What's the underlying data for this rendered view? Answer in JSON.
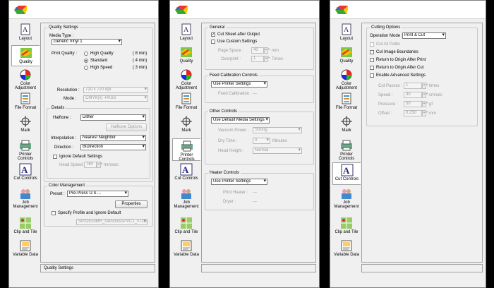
{
  "sidebar_labels": {
    "layout": "Layout",
    "quality": "Quality",
    "color_adjustment": "Color Adjustment",
    "file_format": "File Format",
    "mark": "Mark",
    "printer_controls": "Printer Controls",
    "cut_controls": "Cut Controls",
    "job_management": "Job Management",
    "clip_and_tile": "Clip and Tile",
    "variable_data": "Variable Data"
  },
  "panel1": {
    "quality_settings": {
      "title": "Quality Settings",
      "media_type_label": "Media Type :",
      "media_type_value": "Generic Vinyl 1",
      "print_quality_label": "Print Quality :",
      "options": [
        {
          "label": "High Quality",
          "time": "( 8 min)"
        },
        {
          "label": "Standard",
          "time": "( 4 min)"
        },
        {
          "label": "High Speed",
          "time": "( 3 min)"
        }
      ],
      "resolution_label": "Resolution :",
      "resolution_value": "720 x 720 dpi",
      "mode_label": "Mode :",
      "mode_value": "CMYK(v) -PASS",
      "details_title": "Details",
      "halftone_label": "Halftone :",
      "halftone_value": "Dither",
      "halftone_options_button": "Halftone Options",
      "interpolation_label": "Interpolation :",
      "interpolation_value": "Nearest Neighbor",
      "direction_label": "Direction :",
      "direction_value": "BiDirection",
      "ignore_defaults_label": "Ignore Default Settings",
      "head_speed_label": "Head Speed",
      "head_speed_value": "760",
      "head_speed_unit": "mm/sec"
    },
    "color_management": {
      "title": "Color Management",
      "preset_label": "Preset :",
      "preset_value": "Pre-Press U.S....",
      "properties_button": "Properties",
      "specify_profile_label": "Specify Profile and Ignore Default",
      "profile_value": "SPx2EcoMH_GenGlossPVC1_v720x720.icc"
    },
    "status": "Quality Settings"
  },
  "panel2": {
    "general": {
      "title": "General",
      "cut_sheet_label": "Cut Sheet after Output",
      "use_custom_label": "Use Custom Settings",
      "page_space_label": "Page Space :",
      "page_space_value": "40",
      "page_space_unit": "mm",
      "overprint_label": "Overprint :",
      "overprint_value": "1",
      "overprint_unit": "Times"
    },
    "feed_calibration": {
      "title": "Feed Calibration Controls",
      "dropdown_value": "Use Printer Settings",
      "feed_label": "Feed Calibration :",
      "feed_value": "---"
    },
    "other_controls": {
      "title": "Other Controls",
      "dropdown_value": "Use Default Media Settings",
      "vacuum_label": "Vacuum Power :",
      "vacuum_value": "Strong",
      "dry_time_label": "Dry Time :",
      "dry_time_value": "0",
      "dry_time_unit": "Minutes",
      "head_height_label": "Head Height :",
      "head_height_value": "Normal"
    },
    "heater_controls": {
      "title": "Heater Controls",
      "dropdown_value": "Use Printer Settings",
      "print_heater_label": "Print Heater :",
      "print_heater_value": "---",
      "dryer_label": "Dryer :",
      "dryer_value": "---"
    }
  },
  "panel3": {
    "cutting_options": {
      "title": "Cutting Options",
      "operation_mode_label": "Operation Mode :",
      "operation_mode_value": "Print & Cut",
      "cut_all_paths": "Cut All Paths",
      "cut_image_boundaries": "Cut Image Boundaries",
      "return_after_print": "Return to Origin After Print",
      "return_after_cut": "Return to Origin After Cut",
      "enable_advanced": "Enable Advanced Settings",
      "cut_passes_label": "Cut Passes :",
      "cut_passes_value": "1",
      "cut_passes_unit": "times",
      "speed_label": "Speed :",
      "speed_value": "30",
      "speed_unit": "cm/sec",
      "pressure_label": "Pressure :",
      "pressure_value": "50",
      "pressure_unit": "gf",
      "offset_label": "Offset :",
      "offset_value": "0.250",
      "offset_unit": "mm"
    }
  }
}
